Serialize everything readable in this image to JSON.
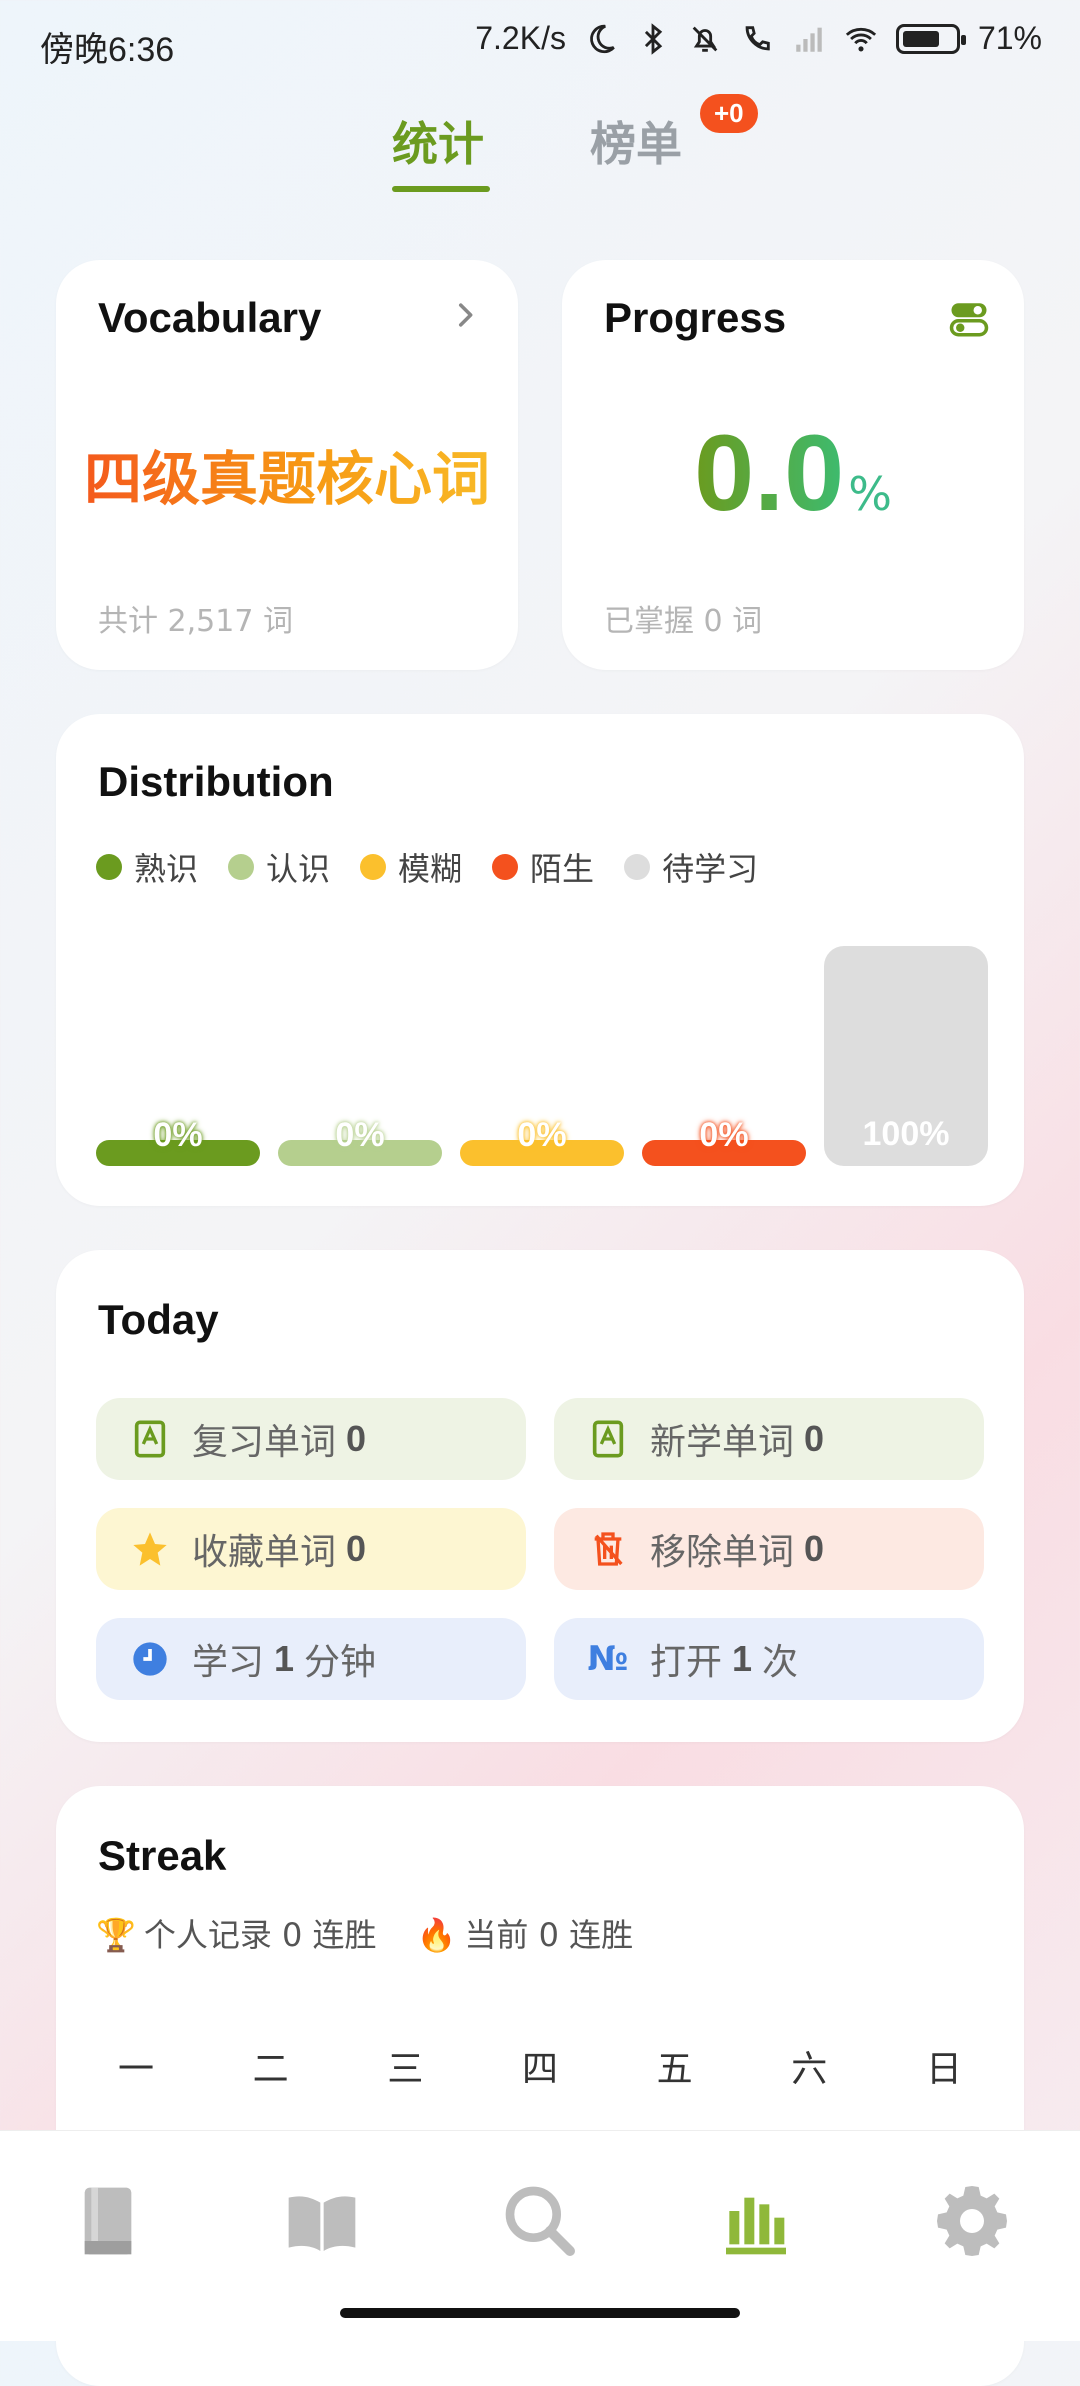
{
  "status_bar": {
    "time": "傍晚6:36",
    "network_speed": "7.2K/s",
    "battery": "71%"
  },
  "tabs": {
    "stats_label": "统计",
    "ranking_label": "榜单",
    "ranking_badge": "+0"
  },
  "vocabulary": {
    "title": "Vocabulary",
    "book_name": "四级真题核心词",
    "total": "共计 2,517 词"
  },
  "progress": {
    "title": "Progress",
    "percent": "0.0",
    "unit": "%",
    "mastered": "已掌握 0 词"
  },
  "distribution": {
    "title": "Distribution",
    "legend": [
      {
        "label": "熟识",
        "color": "#6b9b1f"
      },
      {
        "label": "认识",
        "color": "#b5cf8e"
      },
      {
        "label": "模糊",
        "color": "#fbc02d"
      },
      {
        "label": "陌生",
        "color": "#f4511e"
      },
      {
        "label": "待学习",
        "color": "#dddddd"
      }
    ],
    "chart_data": {
      "type": "bar",
      "categories": [
        "熟识",
        "认识",
        "模糊",
        "陌生",
        "待学习"
      ],
      "values": [
        0,
        0,
        0,
        0,
        100
      ],
      "labels": [
        "0%",
        "0%",
        "0%",
        "0%",
        "100%"
      ],
      "colors": [
        "#6b9b1f",
        "#b5cf8e",
        "#fbc02d",
        "#f4511e",
        "#dddddd"
      ]
    }
  },
  "today": {
    "title": "Today",
    "review": {
      "label": "复习单词",
      "value": "0"
    },
    "new": {
      "label": "新学单词",
      "value": "0"
    },
    "favorite": {
      "label": "收藏单词",
      "value": "0"
    },
    "removed": {
      "label": "移除单词",
      "value": "0"
    },
    "study": {
      "prefix": "学习",
      "value": "1",
      "suffix": "分钟"
    },
    "opens": {
      "prefix": "打开",
      "value": "1",
      "suffix": "次"
    }
  },
  "streak": {
    "title": "Streak",
    "record": "个人记录 0 连胜",
    "current": "当前 0 连胜",
    "days": [
      "一",
      "二",
      "三",
      "四",
      "五",
      "六",
      "日"
    ]
  },
  "bottom_nav": {
    "items": [
      "book-icon",
      "open-book-icon",
      "search-icon",
      "stats-icon",
      "settings-icon"
    ],
    "active": "stats-icon"
  }
}
